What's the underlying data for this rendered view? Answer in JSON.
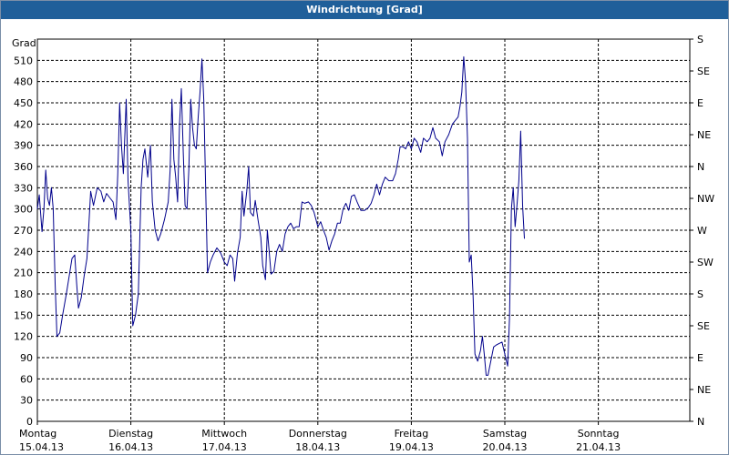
{
  "window": {
    "title": "Windrichtung [Grad]"
  },
  "chart_data": {
    "type": "line",
    "title": "Windrichtung [Grad]",
    "ylabel": "Grad",
    "ylim": [
      0,
      540
    ],
    "yticks": [
      0,
      30,
      60,
      90,
      120,
      150,
      180,
      210,
      240,
      270,
      300,
      330,
      360,
      390,
      420,
      450,
      480,
      510
    ],
    "right_axis_labels": [
      "N",
      "NE",
      "E",
      "SE",
      "S",
      "SW",
      "W",
      "NW",
      "N",
      "NE",
      "E",
      "SE",
      "S"
    ],
    "right_axis_values": [
      0,
      45,
      90,
      135,
      180,
      225,
      270,
      315,
      360,
      405,
      450,
      495,
      540
    ],
    "grid": true,
    "x_unit": "days",
    "xlim": [
      0,
      7
    ],
    "x_ticks": [
      {
        "day": "Montag",
        "date": "15.04.13"
      },
      {
        "day": "Dienstag",
        "date": "16.04.13"
      },
      {
        "day": "Mittwoch",
        "date": "17.04.13"
      },
      {
        "day": "Donnerstag",
        "date": "18.04.13"
      },
      {
        "day": "Freitag",
        "date": "19.04.13"
      },
      {
        "day": "Samstag",
        "date": "20.04.13"
      },
      {
        "day": "Sonntag",
        "date": "21.04.13"
      }
    ],
    "series": [
      {
        "name": "",
        "color": "#00008b",
        "points": [
          [
            0.0,
            300
          ],
          [
            0.02,
            320
          ],
          [
            0.05,
            268
          ],
          [
            0.07,
            300
          ],
          [
            0.09,
            355
          ],
          [
            0.11,
            315
          ],
          [
            0.13,
            305
          ],
          [
            0.15,
            330
          ],
          [
            0.17,
            300
          ],
          [
            0.19,
            195
          ],
          [
            0.21,
            120
          ],
          [
            0.24,
            125
          ],
          [
            0.27,
            150
          ],
          [
            0.31,
            180
          ],
          [
            0.34,
            205
          ],
          [
            0.37,
            230
          ],
          [
            0.4,
            235
          ],
          [
            0.42,
            195
          ],
          [
            0.44,
            160
          ],
          [
            0.47,
            175
          ],
          [
            0.5,
            205
          ],
          [
            0.53,
            230
          ],
          [
            0.55,
            275
          ],
          [
            0.57,
            325
          ],
          [
            0.6,
            305
          ],
          [
            0.64,
            330
          ],
          [
            0.68,
            325
          ],
          [
            0.71,
            310
          ],
          [
            0.74,
            322
          ],
          [
            0.78,
            315
          ],
          [
            0.81,
            310
          ],
          [
            0.84,
            285
          ],
          [
            0.86,
            348
          ],
          [
            0.88,
            450
          ],
          [
            0.9,
            390
          ],
          [
            0.92,
            350
          ],
          [
            0.95,
            455
          ],
          [
            0.97,
            340
          ],
          [
            1.0,
            270
          ],
          [
            1.02,
            135
          ],
          [
            1.05,
            150
          ],
          [
            1.08,
            180
          ],
          [
            1.11,
            330
          ],
          [
            1.13,
            370
          ],
          [
            1.15,
            385
          ],
          [
            1.18,
            345
          ],
          [
            1.21,
            390
          ],
          [
            1.23,
            310
          ],
          [
            1.26,
            270
          ],
          [
            1.29,
            255
          ],
          [
            1.32,
            265
          ],
          [
            1.36,
            285
          ],
          [
            1.4,
            310
          ],
          [
            1.42,
            355
          ],
          [
            1.44,
            455
          ],
          [
            1.46,
            370
          ],
          [
            1.48,
            345
          ],
          [
            1.5,
            310
          ],
          [
            1.52,
            420
          ],
          [
            1.54,
            470
          ],
          [
            1.56,
            380
          ],
          [
            1.58,
            305
          ],
          [
            1.6,
            300
          ],
          [
            1.62,
            355
          ],
          [
            1.64,
            455
          ],
          [
            1.66,
            415
          ],
          [
            1.68,
            390
          ],
          [
            1.7,
            385
          ],
          [
            1.72,
            430
          ],
          [
            1.74,
            465
          ],
          [
            1.76,
            512
          ],
          [
            1.78,
            455
          ],
          [
            1.8,
            330
          ],
          [
            1.82,
            210
          ],
          [
            1.85,
            225
          ],
          [
            1.88,
            235
          ],
          [
            1.92,
            245
          ],
          [
            1.96,
            238
          ],
          [
            2.0,
            225
          ],
          [
            2.03,
            220
          ],
          [
            2.06,
            235
          ],
          [
            2.09,
            230
          ],
          [
            2.11,
            198
          ],
          [
            2.14,
            238
          ],
          [
            2.17,
            260
          ],
          [
            2.19,
            325
          ],
          [
            2.21,
            290
          ],
          [
            2.24,
            325
          ],
          [
            2.26,
            360
          ],
          [
            2.28,
            295
          ],
          [
            2.31,
            290
          ],
          [
            2.33,
            312
          ],
          [
            2.36,
            285
          ],
          [
            2.39,
            260
          ],
          [
            2.41,
            220
          ],
          [
            2.44,
            200
          ],
          [
            2.46,
            270
          ],
          [
            2.48,
            240
          ],
          [
            2.5,
            208
          ],
          [
            2.53,
            212
          ],
          [
            2.56,
            240
          ],
          [
            2.59,
            250
          ],
          [
            2.62,
            240
          ],
          [
            2.65,
            265
          ],
          [
            2.68,
            275
          ],
          [
            2.71,
            280
          ],
          [
            2.74,
            272
          ],
          [
            2.77,
            275
          ],
          [
            2.8,
            275
          ],
          [
            2.83,
            310
          ],
          [
            2.86,
            308
          ],
          [
            2.9,
            310
          ],
          [
            2.93,
            305
          ],
          [
            2.96,
            295
          ],
          [
            3.0,
            275
          ],
          [
            3.03,
            282
          ],
          [
            3.06,
            270
          ],
          [
            3.09,
            260
          ],
          [
            3.12,
            242
          ],
          [
            3.15,
            255
          ],
          [
            3.18,
            265
          ],
          [
            3.21,
            280
          ],
          [
            3.24,
            280
          ],
          [
            3.27,
            300
          ],
          [
            3.3,
            308
          ],
          [
            3.33,
            298
          ],
          [
            3.36,
            318
          ],
          [
            3.39,
            320
          ],
          [
            3.42,
            310
          ],
          [
            3.46,
            298
          ],
          [
            3.5,
            298
          ],
          [
            3.54,
            302
          ],
          [
            3.57,
            308
          ],
          [
            3.6,
            320
          ],
          [
            3.63,
            335
          ],
          [
            3.66,
            320
          ],
          [
            3.69,
            335
          ],
          [
            3.72,
            345
          ],
          [
            3.76,
            340
          ],
          [
            3.8,
            340
          ],
          [
            3.83,
            350
          ],
          [
            3.86,
            370
          ],
          [
            3.88,
            388
          ],
          [
            3.91,
            388
          ],
          [
            3.94,
            385
          ],
          [
            3.97,
            395
          ],
          [
            4.0,
            385
          ],
          [
            4.03,
            400
          ],
          [
            4.06,
            395
          ],
          [
            4.1,
            380
          ],
          [
            4.13,
            400
          ],
          [
            4.17,
            395
          ],
          [
            4.2,
            400
          ],
          [
            4.23,
            415
          ],
          [
            4.26,
            400
          ],
          [
            4.3,
            395
          ],
          [
            4.33,
            375
          ],
          [
            4.36,
            395
          ],
          [
            4.4,
            405
          ],
          [
            4.44,
            420
          ],
          [
            4.47,
            425
          ],
          [
            4.5,
            430
          ],
          [
            4.52,
            445
          ],
          [
            4.54,
            465
          ],
          [
            4.56,
            515
          ],
          [
            4.58,
            480
          ],
          [
            4.6,
            400
          ],
          [
            4.62,
            225
          ],
          [
            4.64,
            235
          ],
          [
            4.66,
            180
          ],
          [
            4.68,
            95
          ],
          [
            4.71,
            85
          ],
          [
            4.74,
            100
          ],
          [
            4.76,
            120
          ],
          [
            4.78,
            95
          ],
          [
            4.8,
            65
          ],
          [
            4.82,
            65
          ],
          [
            4.85,
            85
          ],
          [
            4.88,
            105
          ],
          [
            4.91,
            108
          ],
          [
            4.94,
            110
          ],
          [
            4.97,
            112
          ],
          [
            5.0,
            95
          ],
          [
            5.03,
            78
          ],
          [
            5.05,
            145
          ],
          [
            5.07,
            300
          ],
          [
            5.09,
            330
          ],
          [
            5.11,
            275
          ],
          [
            5.13,
            305
          ],
          [
            5.15,
            340
          ],
          [
            5.17,
            410
          ],
          [
            5.19,
            305
          ],
          [
            5.21,
            258
          ]
        ]
      }
    ]
  }
}
